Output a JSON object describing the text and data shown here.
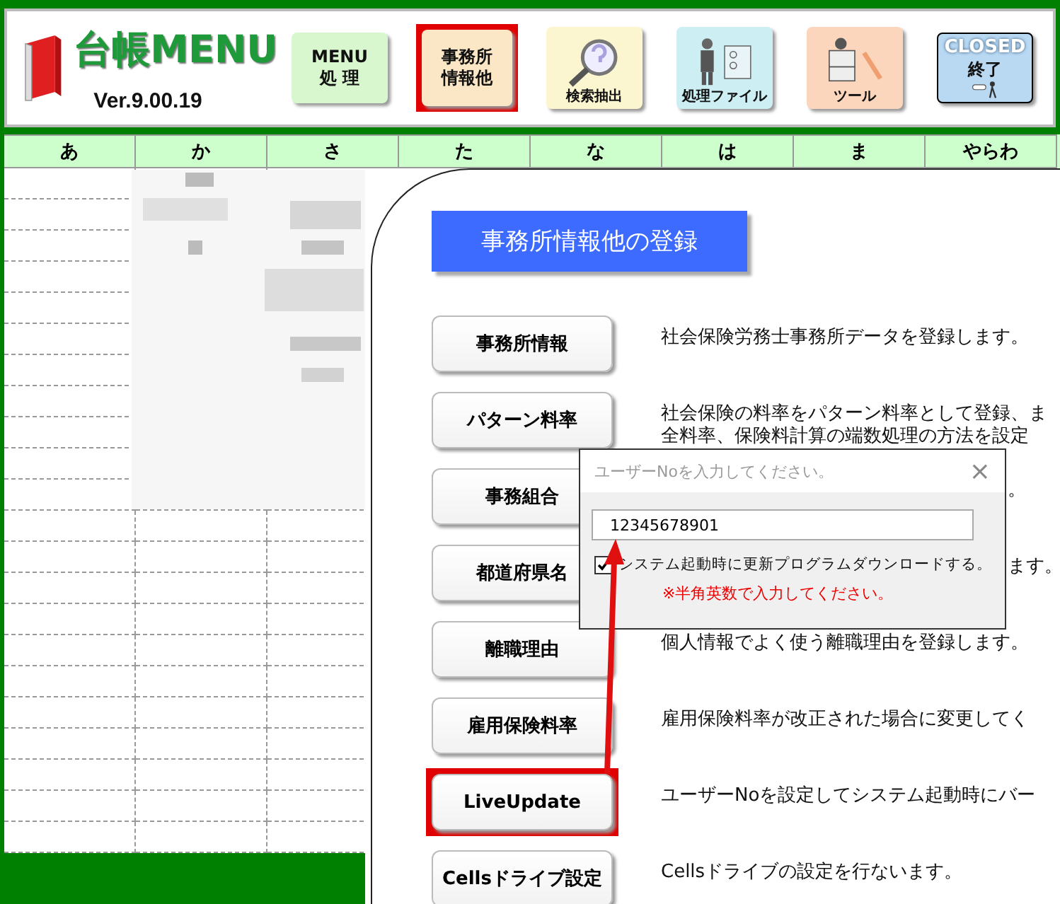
{
  "app": {
    "title": "台帳MENU",
    "version": "Ver.9.00.19"
  },
  "toolbar": [
    {
      "kind": "plain",
      "lines": [
        "MENU",
        "処 理"
      ],
      "color": "#d9f7cf",
      "highlighted": false
    },
    {
      "kind": "plain",
      "lines": [
        "事務所",
        "情報他"
      ],
      "color": "#fbe7c6",
      "highlighted": true
    },
    {
      "kind": "search",
      "lines": [
        "検索抽出"
      ],
      "color": "#fbf6cf",
      "highlighted": false
    },
    {
      "kind": "binder",
      "lines": [
        "処理ファイル"
      ],
      "color": "#cdeef3",
      "highlighted": false
    },
    {
      "kind": "tool",
      "lines": [
        "ツール"
      ],
      "color": "#fbd6bd",
      "highlighted": false
    },
    {
      "kind": "closed",
      "lines": [
        "CLOSED",
        "終了"
      ],
      "color": "#b9d9f3",
      "highlighted": false
    }
  ],
  "index_tabs": [
    "あ",
    "か",
    "さ",
    "た",
    "な",
    "は",
    "ま",
    "やらわ"
  ],
  "panel": {
    "title": "事務所情報他の登録",
    "items": [
      {
        "label": "事務所情報",
        "description": [
          "社会保険労務士事務所データを登録します。"
        ],
        "partly_hidden": false,
        "highlighted": false
      },
      {
        "label": "パターン料率",
        "description": [
          "社会保険の料率をパターン料率として登録、ま",
          "全料率、保険料計算の端数処理の方法を設定"
        ],
        "partly_hidden": false,
        "highlighted": false
      },
      {
        "label": "事務組合",
        "description": [
          "。"
        ],
        "partly_hidden": true,
        "highlighted": false
      },
      {
        "label": "都道府県名",
        "description": [
          "ます。"
        ],
        "partly_hidden": true,
        "highlighted": false
      },
      {
        "label": "離職理由",
        "description": [
          "個人情報でよく使う離職理由を登録します。"
        ],
        "partly_hidden": false,
        "highlighted": false
      },
      {
        "label": "雇用保険料率",
        "description": [
          "雇用保険料率が改正された場合に変更してく"
        ],
        "partly_hidden": false,
        "highlighted": false
      },
      {
        "label": "LiveUpdate",
        "description": [
          "ユーザーNoを設定してシステム起動時にバー"
        ],
        "partly_hidden": false,
        "highlighted": true
      },
      {
        "label": "Cellsドライブ設定",
        "description": [
          "Cellsドライブの設定を行ないます。"
        ],
        "partly_hidden": false,
        "highlighted": false
      }
    ]
  },
  "dialog": {
    "title": "ユーザーNoを入力してください。",
    "close": "×",
    "value": "12345678901",
    "checkbox": {
      "label": "システム起動時に更新プログラムダウンロードする。",
      "checked": true
    },
    "note": "※半角英数で入力してください。"
  }
}
